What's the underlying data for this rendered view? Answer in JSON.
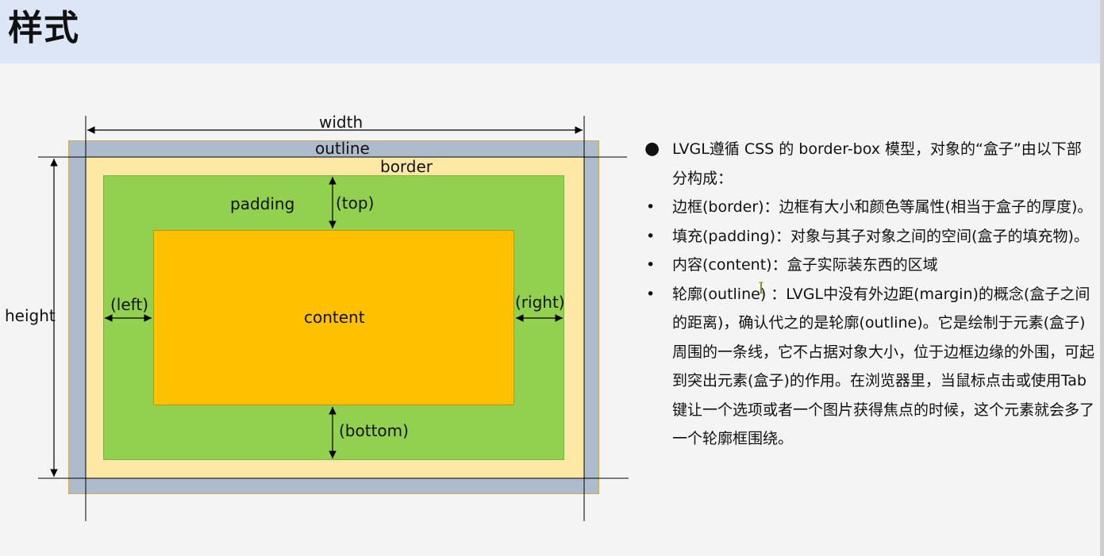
{
  "header": {
    "title": "样式"
  },
  "diagram": {
    "labels": {
      "width": "width",
      "outline": "outline",
      "border": "border",
      "padding": "padding",
      "top": "(top)",
      "left": "(left)",
      "right": "(right)",
      "content": "content",
      "bottom": "(bottom)",
      "height": "height"
    },
    "colors": {
      "outline": "#aebbcd",
      "border": "#fde9a5",
      "padding": "#92d050",
      "content": "#ffc000"
    }
  },
  "bullets": [
    {
      "marker": "●",
      "text": "LVGL遵循 CSS 的 border-box 模型，对象的“盒子”由以下部分构成："
    },
    {
      "marker": "•",
      "text": "边框(border)：边框有大小和颜色等属性(相当于盒子的厚度)。"
    },
    {
      "marker": "•",
      "text": "填充(padding)：对象与其子对象之间的空间(盒子的填充物)。"
    },
    {
      "marker": "•",
      "text": "内容(content)：盒子实际装东西的区域"
    },
    {
      "marker": "•",
      "text": "轮廓(outline) ：LVGL中没有外边距(margin)的概念(盒子之间的距离)，确认代之的是轮廓(outline)。它是绘制于元素(盒子)周围的一条线，它不占据对象大小，位于边框边缘的外围，可起到突出元素(盒子)的作用。在浏览器里，当鼠标点击或使用Tab键让一个选项或者一个图片获得焦点的时候，这个元素就会多了一个轮廓框围绕。"
    }
  ]
}
